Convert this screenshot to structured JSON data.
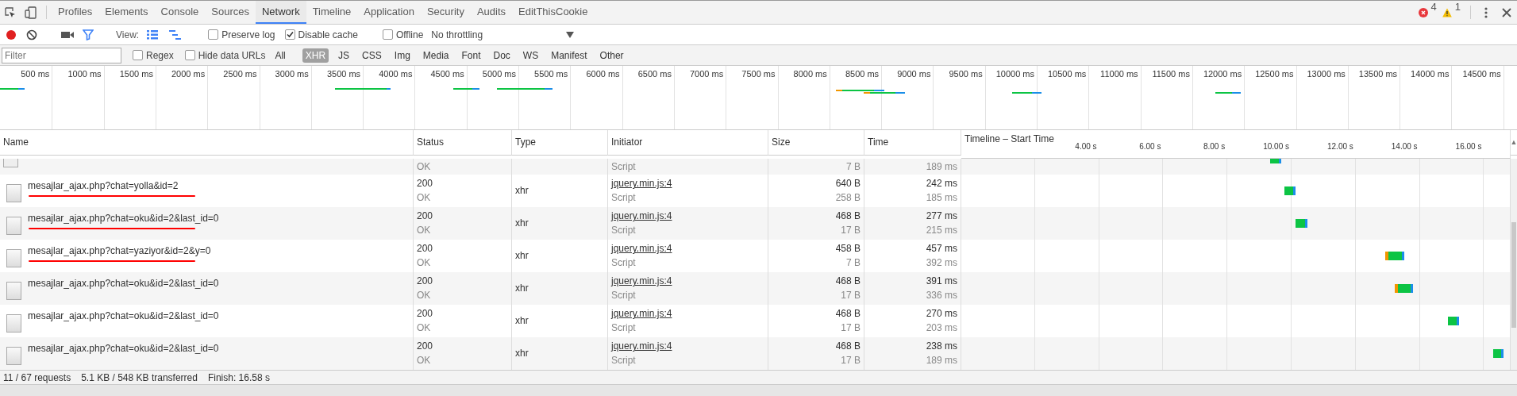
{
  "tabs": [
    {
      "label": "Profiles",
      "selected": false
    },
    {
      "label": "Elements",
      "selected": false
    },
    {
      "label": "Console",
      "selected": false
    },
    {
      "label": "Sources",
      "selected": false
    },
    {
      "label": "Network",
      "selected": true
    },
    {
      "label": "Timeline",
      "selected": false
    },
    {
      "label": "Application",
      "selected": false
    },
    {
      "label": "Security",
      "selected": false
    },
    {
      "label": "Audits",
      "selected": false
    },
    {
      "label": "EditThisCookie",
      "selected": false
    }
  ],
  "issues": {
    "errors": "4",
    "warnings": "1"
  },
  "toolbar": {
    "recording": true,
    "view_label": "View:",
    "view_modes": [
      {
        "kind": "list",
        "on": true
      },
      {
        "kind": "overview",
        "on": true
      }
    ],
    "checkboxes": [
      {
        "label": "Preserve log",
        "checked": false
      },
      {
        "label": "Disable cache",
        "checked": true
      },
      {
        "label": "Offline",
        "checked": false
      }
    ],
    "throttling": "No throttling"
  },
  "filter": {
    "placeholder": "Filter",
    "options": [
      {
        "label": "Regex",
        "checked": false
      },
      {
        "label": "Hide data URLs",
        "checked": false
      }
    ],
    "types": [
      {
        "label": "All",
        "selected": false
      },
      {
        "label": "XHR",
        "selected": true
      },
      {
        "label": "JS",
        "selected": false
      },
      {
        "label": "CSS",
        "selected": false
      },
      {
        "label": "Img",
        "selected": false
      },
      {
        "label": "Media",
        "selected": false
      },
      {
        "label": "Font",
        "selected": false
      },
      {
        "label": "Doc",
        "selected": false
      },
      {
        "label": "WS",
        "selected": false
      },
      {
        "label": "Manifest",
        "selected": false
      },
      {
        "label": "Other",
        "selected": false
      }
    ]
  },
  "overview": {
    "ticks": [
      "500 ms",
      "1000 ms",
      "1500 ms",
      "2000 ms",
      "2500 ms",
      "3000 ms",
      "3500 ms",
      "4000 ms",
      "4500 ms",
      "5000 ms",
      "5500 ms",
      "6000 ms",
      "6500 ms",
      "7000 ms",
      "7500 ms",
      "8000 ms",
      "8500 ms",
      "9000 ms",
      "9500 ms",
      "10000 ms",
      "10500 ms",
      "11000 ms",
      "11500 ms",
      "12000 ms",
      "12500 ms",
      "13000 ms",
      "13500 ms",
      "14000 ms",
      "14500 ms"
    ]
  },
  "table": {
    "columns": [
      "Name",
      "Status",
      "Type",
      "Initiator",
      "Size",
      "Time",
      "Timeline – Start Time"
    ],
    "timeline_ticks": [
      "4.00 s",
      "6.00 s",
      "8.00 s",
      "10.00 s",
      "12.00 s",
      "14.00 s",
      "16.00 s"
    ],
    "sort_indicator": "▲",
    "rows": [
      {
        "kind": "partial",
        "status_text": "OK",
        "initiator_type": "Script",
        "resource_size": "7 B",
        "latency": "189 ms"
      },
      {
        "kind": "full",
        "name": "mesajlar_ajax.php?chat=yolla&id=2",
        "annotated": true,
        "status": "200",
        "status_text": "OK",
        "type": "xhr",
        "initiator": "jquery.min.js:4",
        "initiator_type": "Script",
        "size": "640 B",
        "resource_size": "258 B",
        "time": "242 ms",
        "latency": "185 ms"
      },
      {
        "kind": "full",
        "name": "mesajlar_ajax.php?chat=oku&id=2&last_id=0",
        "annotated": true,
        "status": "200",
        "status_text": "OK",
        "type": "xhr",
        "initiator": "jquery.min.js:4",
        "initiator_type": "Script",
        "size": "468 B",
        "resource_size": "17 B",
        "time": "277 ms",
        "latency": "215 ms"
      },
      {
        "kind": "full",
        "name": "mesajlar_ajax.php?chat=yaziyor&id=2&y=0",
        "annotated": true,
        "status": "200",
        "status_text": "OK",
        "type": "xhr",
        "initiator": "jquery.min.js:4",
        "initiator_type": "Script",
        "size": "458 B",
        "resource_size": "7 B",
        "time": "457 ms",
        "latency": "392 ms"
      },
      {
        "kind": "full",
        "name": "mesajlar_ajax.php?chat=oku&id=2&last_id=0",
        "annotated": false,
        "status": "200",
        "status_text": "OK",
        "type": "xhr",
        "initiator": "jquery.min.js:4",
        "initiator_type": "Script",
        "size": "468 B",
        "resource_size": "17 B",
        "time": "391 ms",
        "latency": "336 ms"
      },
      {
        "kind": "full",
        "name": "mesajlar_ajax.php?chat=oku&id=2&last_id=0",
        "annotated": false,
        "status": "200",
        "status_text": "OK",
        "type": "xhr",
        "initiator": "jquery.min.js:4",
        "initiator_type": "Script",
        "size": "468 B",
        "resource_size": "17 B",
        "time": "270 ms",
        "latency": "203 ms"
      },
      {
        "kind": "full",
        "name": "mesajlar_ajax.php?chat=oku&id=2&last_id=0",
        "annotated": false,
        "status": "200",
        "status_text": "OK",
        "type": "xhr",
        "initiator": "jquery.min.js:4",
        "initiator_type": "Script",
        "size": "468 B",
        "resource_size": "17 B",
        "time": "238 ms",
        "latency": "189 ms"
      }
    ]
  },
  "summary": [
    "11 / 67 requests",
    "5.1 KB / 548 KB transferred",
    "Finish: 16.58 s"
  ]
}
